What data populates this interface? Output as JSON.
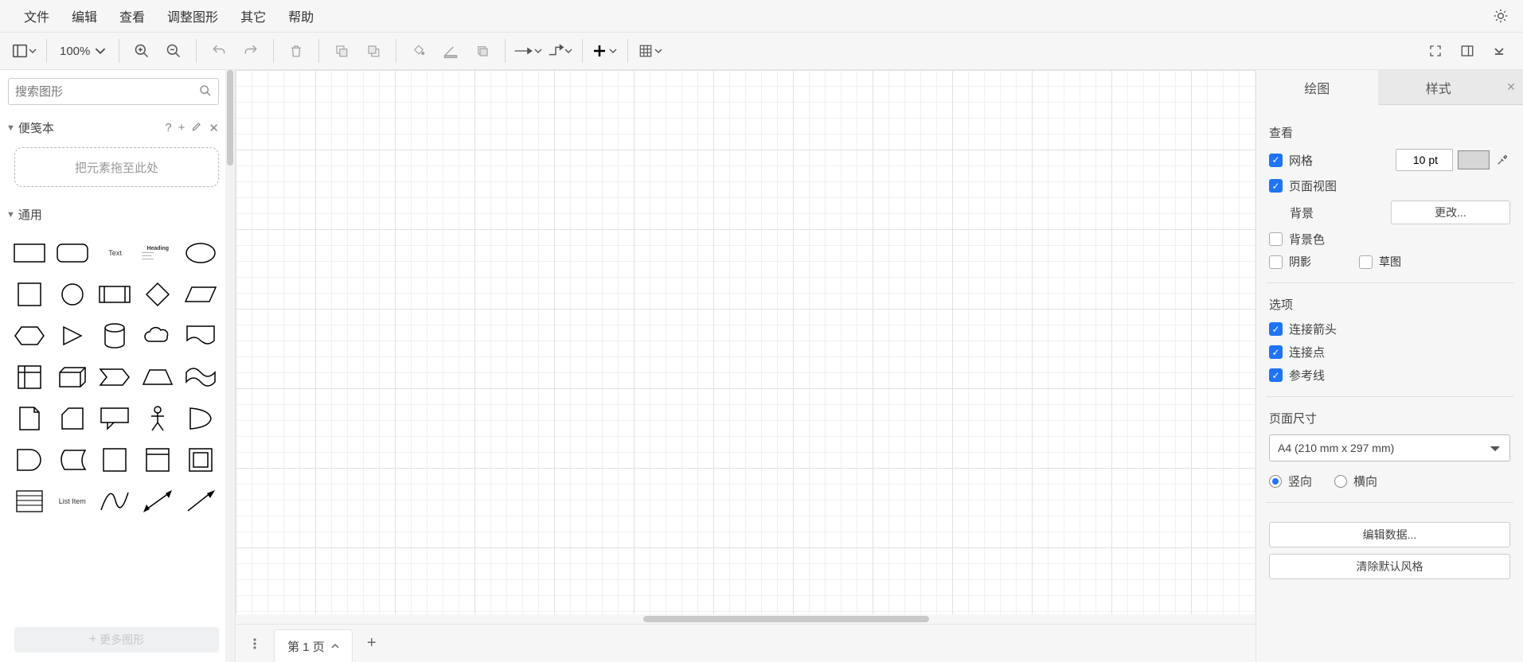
{
  "menubar": {
    "items": [
      "文件",
      "编辑",
      "查看",
      "调整图形",
      "其它",
      "帮助"
    ]
  },
  "toolbar": {
    "zoom": "100%"
  },
  "search": {
    "placeholder": "搜索图形"
  },
  "scratchpad": {
    "title": "便笺本",
    "drop_hint": "把元素拖至此处"
  },
  "general_section": {
    "title": "通用",
    "shape_text_label": "Text",
    "shape_heading_label": "Heading",
    "shape_listitem_label": "List Item"
  },
  "more_shapes": {
    "label": "更多图形"
  },
  "page_tabs": {
    "page1": "第 1 页"
  },
  "right_panel": {
    "tab_diagram": "绘图",
    "tab_style": "样式",
    "section_view": "查看",
    "grid": "网格",
    "grid_value": "10 pt",
    "page_view": "页面视图",
    "background": "背景",
    "change_btn": "更改...",
    "background_color": "背景色",
    "shadow": "阴影",
    "sketch": "草图",
    "section_options": "选项",
    "connection_arrows": "连接箭头",
    "connection_points": "连接点",
    "guides": "参考线",
    "section_page_size": "页面尺寸",
    "size_value": "A4 (210 mm x 297 mm)",
    "portrait": "竖向",
    "landscape": "横向",
    "edit_data": "编辑数据...",
    "clear_default": "清除默认风格"
  }
}
